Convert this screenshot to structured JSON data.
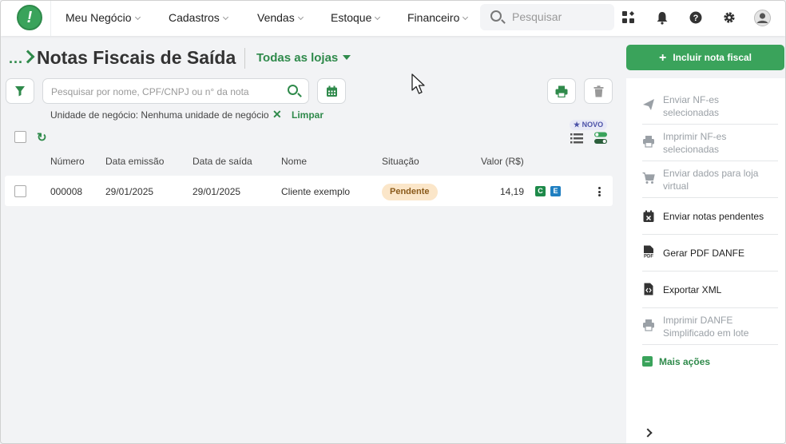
{
  "nav": {
    "items": [
      {
        "label": "Meu Negócio"
      },
      {
        "label": "Cadastros"
      },
      {
        "label": "Vendas"
      },
      {
        "label": "Estoque"
      },
      {
        "label": "Financeiro"
      }
    ],
    "search_placeholder": "Pesquisar"
  },
  "header": {
    "breadcrumb_ellipsis": "...",
    "title": "Notas Fiscais de Saída",
    "store_selector": "Todas as lojas"
  },
  "filters": {
    "search_placeholder": "Pesquisar por nome, CPF/CNPJ ou n° da nota",
    "active_filter": "Unidade de negócio: Nenhuma unidade de negócio",
    "remove_filter": "✕",
    "clear_label": "Limpar"
  },
  "view": {
    "new_badge": "★ NOVO"
  },
  "table": {
    "columns": [
      "Número",
      "Data emissão",
      "Data de saída",
      "Nome",
      "Situação",
      "Valor (R$)"
    ],
    "rows": [
      {
        "numero": "000008",
        "data_emissao": "29/01/2025",
        "data_saida": "29/01/2025",
        "nome": "Cliente exemplo",
        "situacao": "Pendente",
        "valor": "14,19",
        "tag_c": "C",
        "tag_e": "E"
      }
    ]
  },
  "side": {
    "include_button": "Incluir nota fiscal",
    "actions": [
      {
        "label_1": "Enviar NF-es",
        "label_2": "selecionadas",
        "icon": "send-icon",
        "enabled": false
      },
      {
        "label_1": "Imprimir NF-es",
        "label_2": "selecionadas",
        "icon": "printer-icon",
        "enabled": false
      },
      {
        "label_1": "Enviar dados para loja",
        "label_2": "virtual",
        "icon": "cart-icon",
        "enabled": false
      },
      {
        "label_1": "Enviar notas pendentes",
        "icon": "calendar-x-icon",
        "enabled": true
      },
      {
        "label_1": "Gerar PDF DANFE",
        "icon": "pdf-icon",
        "enabled": true
      },
      {
        "label_1": "Exportar XML",
        "icon": "code-file-icon",
        "enabled": true
      },
      {
        "label_1": "Imprimir DANFE",
        "label_2": "Simplificado em lote",
        "icon": "printer-icon",
        "enabled": false
      }
    ],
    "more_actions": "Mais ações"
  },
  "colors": {
    "brand_green": "#3aa35b",
    "dark_green": "#2f8a4b",
    "pending_bg": "#fbe6c9",
    "tag_c": "#1e8a4a",
    "tag_e": "#1f7fc1"
  }
}
